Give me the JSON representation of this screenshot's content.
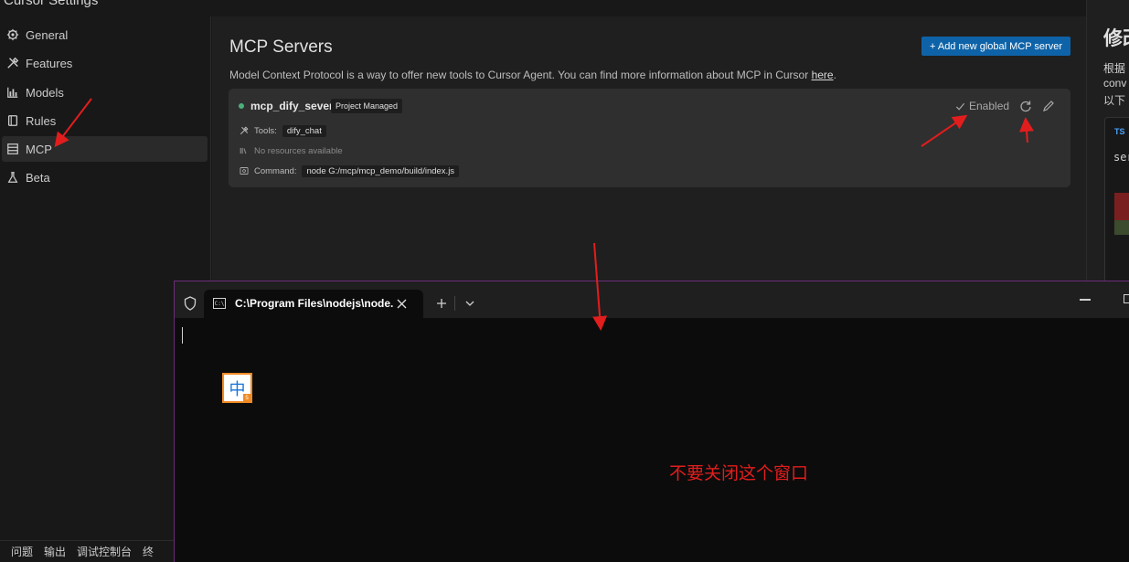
{
  "settings": {
    "title": "Cursor Settings"
  },
  "sidebar": {
    "items": [
      {
        "label": "General"
      },
      {
        "label": "Features"
      },
      {
        "label": "Models"
      },
      {
        "label": "Rules"
      },
      {
        "label": "MCP"
      },
      {
        "label": "Beta"
      }
    ],
    "active": "MCP"
  },
  "main": {
    "title": "MCP Servers",
    "description": "Model Context Protocol is a way to offer new tools to Cursor Agent. You can find more information about MCP in Cursor ",
    "description_link": "here",
    "description_end": ".",
    "add_button_label": "+ Add new global MCP server",
    "server": {
      "name": "mcp_dify_sever",
      "badge": "Project Managed",
      "status": "Enabled",
      "tools_label": "Tools:",
      "tool": "dify_chat",
      "resources": "No resources available",
      "command_label": "Command:",
      "command": "node G:/mcp/mcp_demo/build/index.js"
    }
  },
  "right_panel": {
    "heading": "修改",
    "lines": [
      "根据",
      "conv",
      "以下"
    ],
    "code_lang": "TS",
    "code_text": "ser"
  },
  "panel_tabs": [
    "问题",
    "输出",
    "调试控制台",
    "终"
  ],
  "terminal": {
    "tab_title": "C:\\Program Files\\nodejs\\node.",
    "ime_char": "中",
    "ime_sub": "S",
    "annotation": "不要关闭这个窗口"
  },
  "colors": {
    "accent_button": "#0e63a8",
    "status_dot": "#4caf7a",
    "annotation": "#e21d1d",
    "terminal_border": "#6b2c7a"
  }
}
